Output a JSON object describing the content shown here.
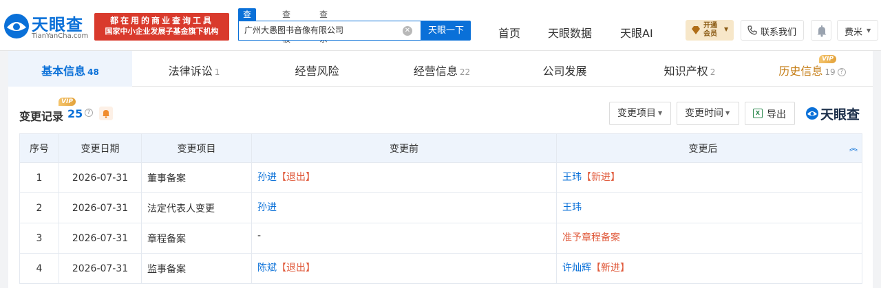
{
  "header": {
    "logo_text": "天眼查",
    "logo_sub": "TianYanCha.com",
    "slogan_line1": "都在用的商业查询工具",
    "slogan_line2": "国家中小企业发展子基金旗下机构",
    "search_tabs": [
      "查公司",
      "查老板",
      "查关系"
    ],
    "search_value": "广州大愚图书音像有限公司",
    "search_button": "天眼一下",
    "nav": [
      "首页",
      "天眼数据",
      "天眼AI"
    ],
    "vip_open_line1": "开通",
    "vip_open_line2": "会员",
    "contact": "联系我们",
    "user_name": "费米"
  },
  "tabs": [
    {
      "label": "基本信息",
      "count": "48"
    },
    {
      "label": "法律诉讼",
      "count": "1"
    },
    {
      "label": "经营风险",
      "count": ""
    },
    {
      "label": "经营信息",
      "count": "22"
    },
    {
      "label": "公司发展",
      "count": ""
    },
    {
      "label": "知识产权",
      "count": "2"
    },
    {
      "label": "历史信息",
      "count": "19"
    }
  ],
  "vip_label": "VIP",
  "section": {
    "title": "变更记录",
    "count": "25",
    "filter_item": "变更项目",
    "filter_time": "变更时间",
    "export": "导出",
    "watermark": "天眼查"
  },
  "table": {
    "columns": [
      "序号",
      "变更日期",
      "变更项目",
      "变更前",
      "变更后"
    ],
    "rows": [
      {
        "no": "1",
        "date": "2026-07-31",
        "item": "董事备案",
        "before_name": "孙进",
        "before_tag": "【退出】",
        "after_name": "王玮",
        "after_tag": "【新进】"
      },
      {
        "no": "2",
        "date": "2026-07-31",
        "item": "法定代表人变更",
        "before_name": "孙进",
        "before_tag": "",
        "after_name": "王玮",
        "after_tag": ""
      },
      {
        "no": "3",
        "date": "2026-07-31",
        "item": "章程备案",
        "before_name": "-",
        "before_tag": "",
        "after_name": "准予章程备案",
        "after_tag": ""
      },
      {
        "no": "4",
        "date": "2026-07-31",
        "item": "监事备案",
        "before_name": "陈斌",
        "before_tag": "【退出】",
        "after_name": "许灿辉",
        "after_tag": "【新进】"
      }
    ]
  }
}
